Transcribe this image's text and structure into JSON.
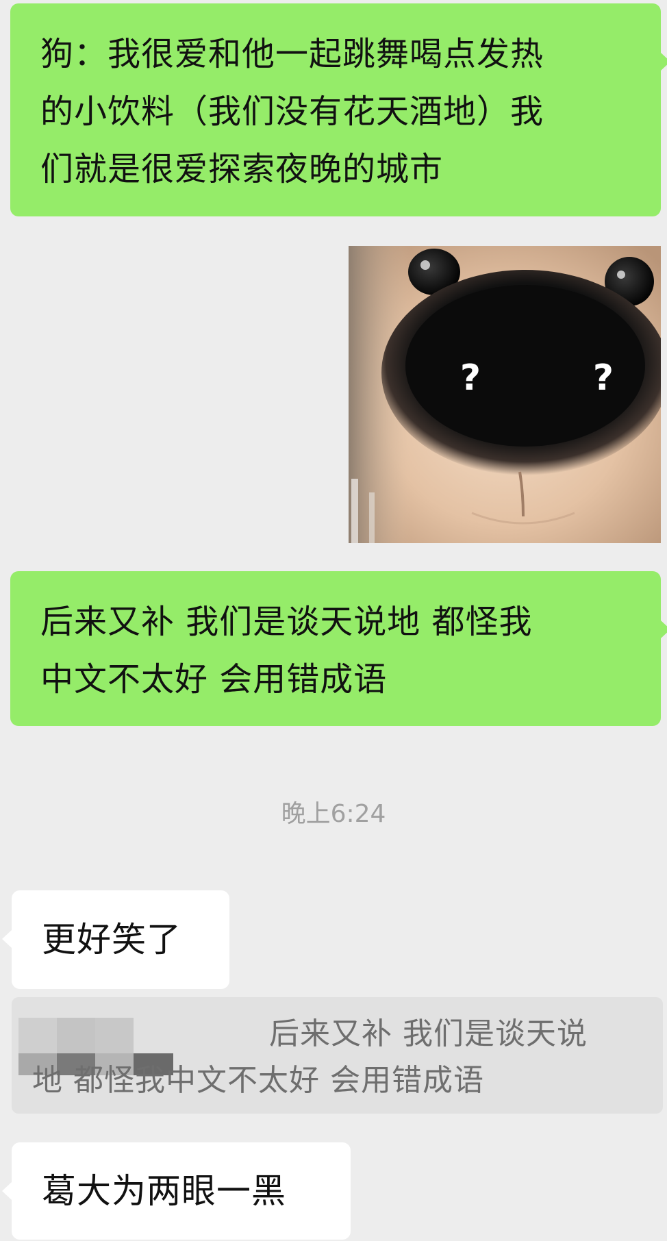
{
  "messages": [
    {
      "id": "msg-1",
      "direction": "outgoing",
      "lines": [
        "狗：我很爱和他一起跳舞喝点发热",
        "的小饮料（我们没有花天酒地）我",
        "们就是很爱探索夜晚的城市"
      ]
    },
    {
      "id": "msg-2",
      "direction": "outgoing",
      "type": "sticker",
      "sticker": "dog-nose-question-marks",
      "overlay_text": [
        "?",
        "?"
      ]
    },
    {
      "id": "msg-3",
      "direction": "outgoing",
      "lines": [
        "后来又补 我们是谈天说地 都怪我",
        "中文不太好 会用错成语"
      ]
    }
  ],
  "timestamp": "晚上6:24",
  "incoming": [
    {
      "id": "msg-4",
      "text": "更好笑了"
    },
    {
      "id": "msg-5",
      "text": "葛大为两眼一黑"
    }
  ],
  "quote": {
    "sender": "(pixelated)",
    "line1": "后来又补 我们是谈天说",
    "line2": "地 都怪我中文不太好 会用错成语"
  },
  "colors": {
    "background": "#ededed",
    "outgoing_bubble": "#95ec69",
    "incoming_bubble": "#ffffff",
    "quote_bg": "#e1e1e1",
    "timestamp": "#a0a0a0"
  }
}
